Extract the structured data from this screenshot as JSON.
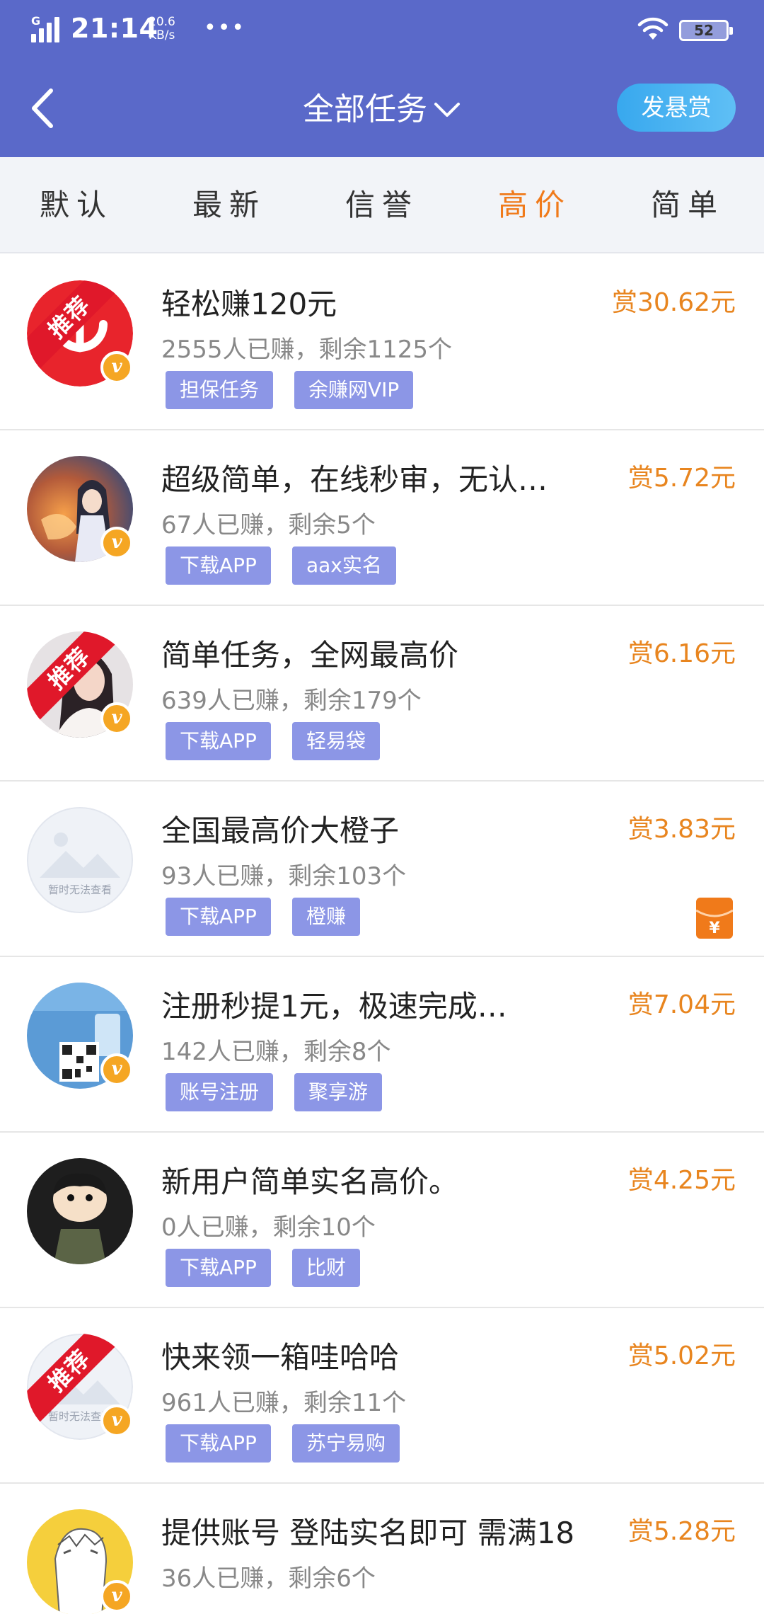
{
  "status_bar": {
    "network": "G",
    "time": "21:14",
    "speed_value": "20.6",
    "speed_unit": "KB/s",
    "dots": "•••",
    "battery": "52"
  },
  "header": {
    "back_icon": "chevron-left-icon",
    "title": "全部任务",
    "title_icon": "chevron-down-icon",
    "post_button": "发悬赏"
  },
  "tabs": [
    {
      "label": "默认",
      "active": false
    },
    {
      "label": "最新",
      "active": false
    },
    {
      "label": "信誉",
      "active": false
    },
    {
      "label": "高价",
      "active": true
    },
    {
      "label": "简单",
      "active": false
    }
  ],
  "colors": {
    "header_bg": "#5a69c9",
    "active_tab": "#f07a1a",
    "reward": "#e8851f",
    "tag_bg": "#8c96e6",
    "ribbon": "#e0182a",
    "badge": "#f5a623"
  },
  "tasks": [
    {
      "title": "轻松赚120元",
      "earned": "2555人已赚，剩余1125个",
      "reward": "赏30.62元",
      "tags": [
        "担保任务",
        "余赚网VIP"
      ],
      "recommended": true,
      "ribbon": "推荐",
      "avatar_icon": "red-app-logo-icon",
      "badge": "v"
    },
    {
      "title": "超级简单，在线秒审，无认…",
      "earned": "67人已赚，剩余5个",
      "reward": "赏5.72元",
      "tags": [
        "下载APP",
        "aax实名"
      ],
      "recommended": false,
      "avatar_icon": "anime-character-avatar-icon",
      "badge": "v"
    },
    {
      "title": "简单任务，全网最高价",
      "earned": "639人已赚，剩余179个",
      "reward": "赏6.16元",
      "tags": [
        "下载APP",
        "轻易袋"
      ],
      "recommended": true,
      "ribbon": "推荐",
      "avatar_icon": "woman-photo-avatar-icon",
      "badge": "v"
    },
    {
      "title": "全国最高价大橙子",
      "earned": "93人已赚，剩余103个",
      "reward": "赏3.83元",
      "tags": [
        "下载APP",
        "橙赚"
      ],
      "recommended": false,
      "avatar_icon": "placeholder-image-icon",
      "avatar_caption": "暂时无法查看",
      "has_red_packet": true,
      "red_packet_icon": "red-packet-icon",
      "red_packet_symbol": "¥"
    },
    {
      "title": "注册秒提1元，极速完成…",
      "earned": "142人已赚，剩余8个",
      "reward": "赏7.04元",
      "tags": [
        "账号注册",
        "聚享游"
      ],
      "recommended": false,
      "avatar_icon": "qr-code-poster-icon",
      "badge": "v"
    },
    {
      "title": "新用户简单实名高价。",
      "earned": "0人已赚，剩余10个",
      "reward": "赏4.25元",
      "tags": [
        "下载APP",
        "比财"
      ],
      "recommended": false,
      "avatar_icon": "cartoon-boy-avatar-icon"
    },
    {
      "title": "快来领一箱哇哈哈",
      "earned": "961人已赚，剩余11个",
      "reward": "赏5.02元",
      "tags": [
        "下载APP",
        "苏宁易购"
      ],
      "recommended": true,
      "ribbon": "推荐",
      "avatar_icon": "placeholder-image-icon",
      "avatar_caption": "暂时无法查看",
      "badge": "v"
    },
    {
      "title": "提供账号 登陆实名即可 需满18",
      "earned": "36人已赚，剩余6个",
      "reward": "赏5.28元",
      "tags": [],
      "recommended": false,
      "avatar_icon": "anime-sketch-avatar-icon",
      "badge": "v"
    }
  ]
}
